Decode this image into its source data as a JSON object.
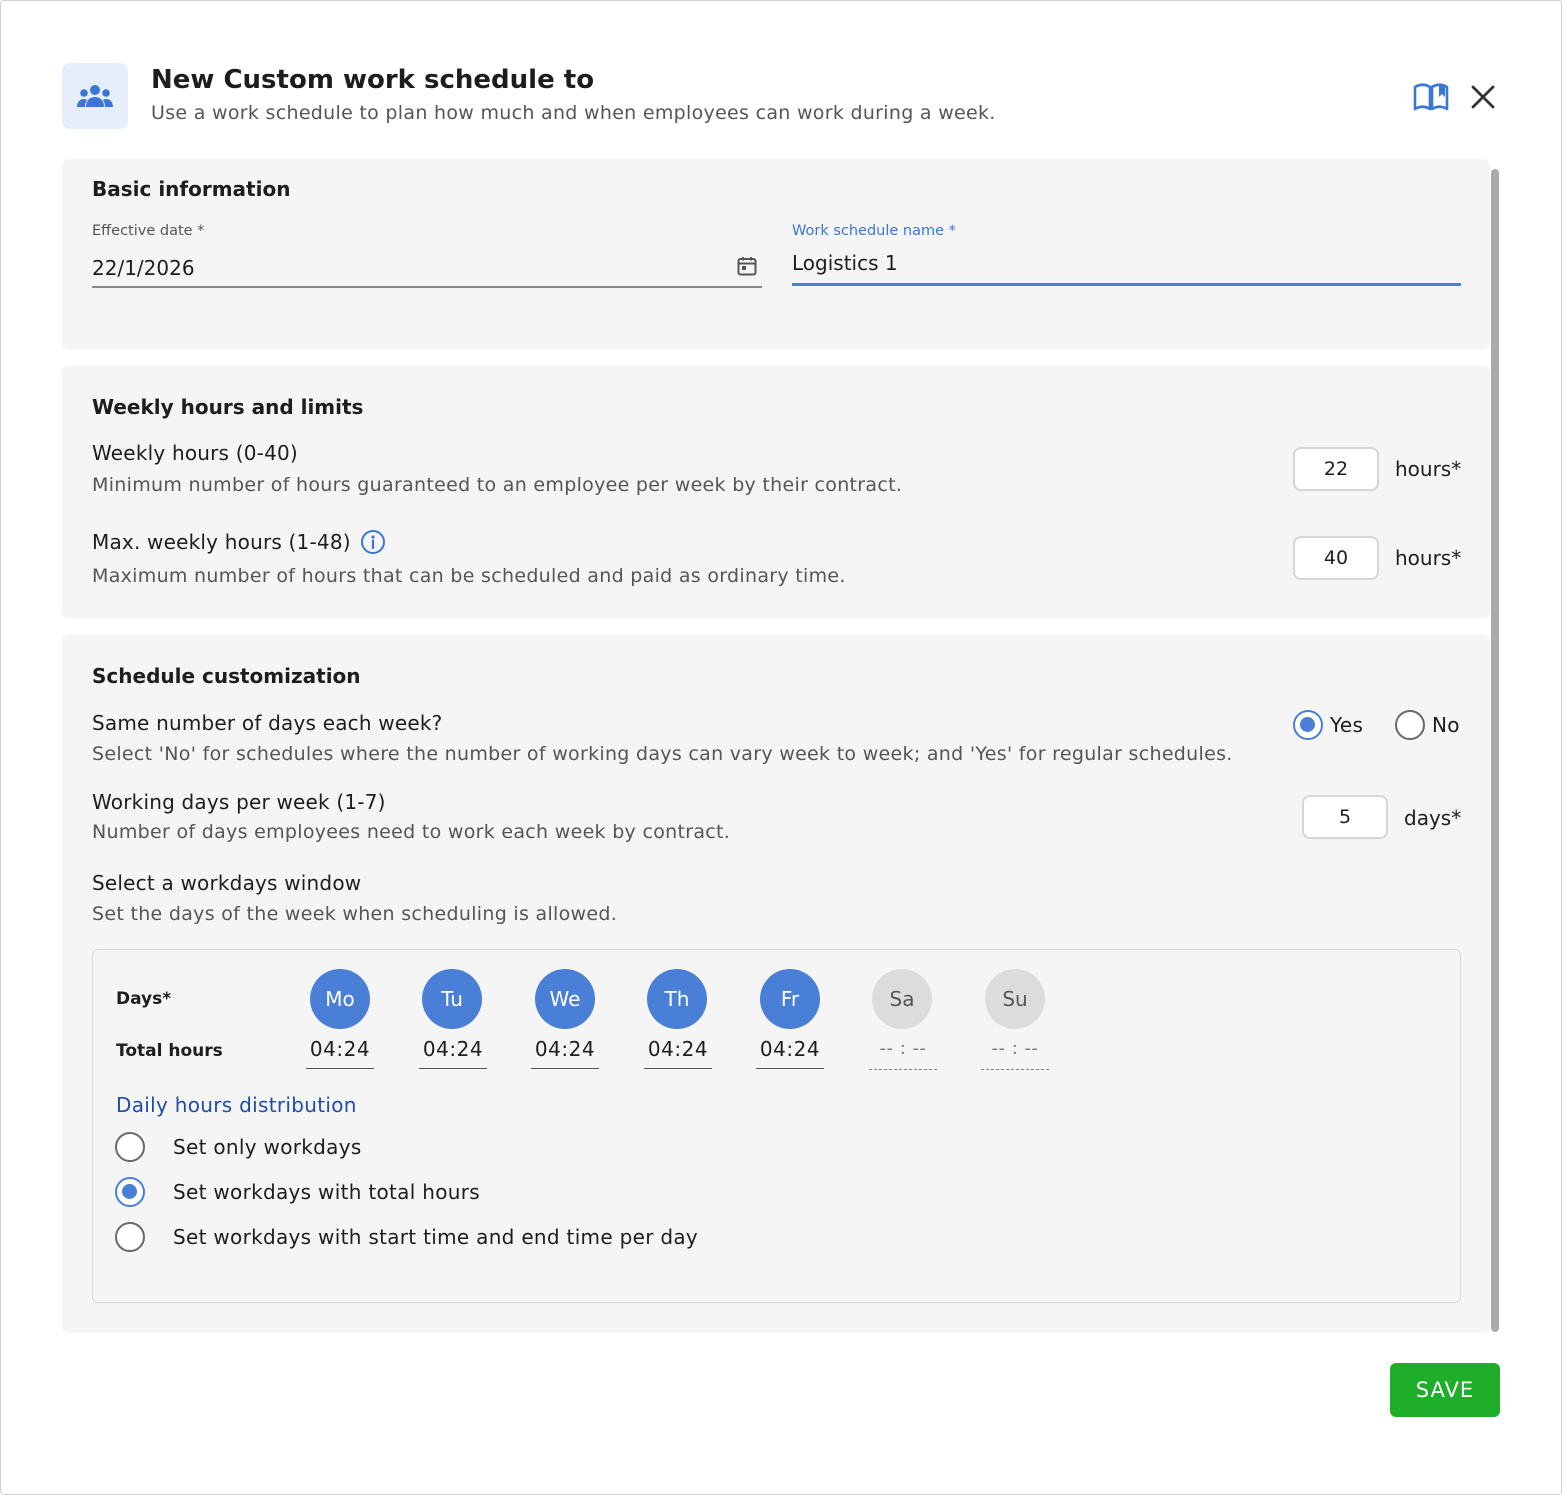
{
  "header": {
    "title": "New Custom work schedule to",
    "subtitle": "Use a work schedule to plan how much and when employees can work during a week.",
    "icon": "people-group-icon",
    "help_icon": "book-icon",
    "close_icon": "close-icon"
  },
  "basic": {
    "title": "Basic information",
    "effective_date": {
      "label": "Effective date *",
      "value": "22/1/2026",
      "icon": "calendar-icon"
    },
    "schedule_name": {
      "label": "Work schedule name *",
      "value": "Logistics 1"
    }
  },
  "weekly": {
    "title": "Weekly hours and limits",
    "weekly_hours": {
      "title": "Weekly hours (0-40)",
      "desc": "Minimum number of hours guaranteed to an employee per week by their contract.",
      "value": "22",
      "unit": "hours*"
    },
    "max_hours": {
      "title": "Max. weekly hours (1-48)",
      "desc": "Maximum number of hours that can be scheduled and paid as ordinary time.",
      "value": "40",
      "unit": "hours*",
      "icon": "info-icon"
    }
  },
  "custom": {
    "title": "Schedule customization",
    "same_days": {
      "title": "Same number of days each week?",
      "desc": "Select 'No' for schedules where the number of working days can vary week to week; and 'Yes' for regular schedules.",
      "yes": "Yes",
      "no": "No",
      "selected": "Yes"
    },
    "working_days": {
      "title": "Working days per week (1-7)",
      "desc": "Number of days employees need to work each week by contract.",
      "value": "5",
      "unit": "days*"
    },
    "window": {
      "title": "Select a workdays window",
      "desc": "Set the days of the week when scheduling is allowed.",
      "days_label": "Days*",
      "hours_label": "Total hours",
      "days": [
        {
          "label": "Mo",
          "hours": "04:24"
        },
        {
          "label": "Tu",
          "hours": "04:24"
        },
        {
          "label": "We",
          "hours": "04:24"
        },
        {
          "label": "Th",
          "hours": "04:24"
        },
        {
          "label": "Fr",
          "hours": "04:24"
        },
        {
          "label": "Sa",
          "hours": "-- : --"
        },
        {
          "label": "Su",
          "hours": "-- : --"
        }
      ],
      "distribution": {
        "title": "Daily hours distribution",
        "options": [
          "Set only workdays",
          "Set workdays with total hours",
          "Set workdays with start time and end time per day"
        ],
        "selected": "Set workdays with total hours"
      }
    }
  },
  "footer": {
    "save_label": "SAVE"
  },
  "colors": {
    "accent": "#4a7fd8",
    "save": "#1fae2a",
    "inactive_day": "#dcdcdc"
  }
}
